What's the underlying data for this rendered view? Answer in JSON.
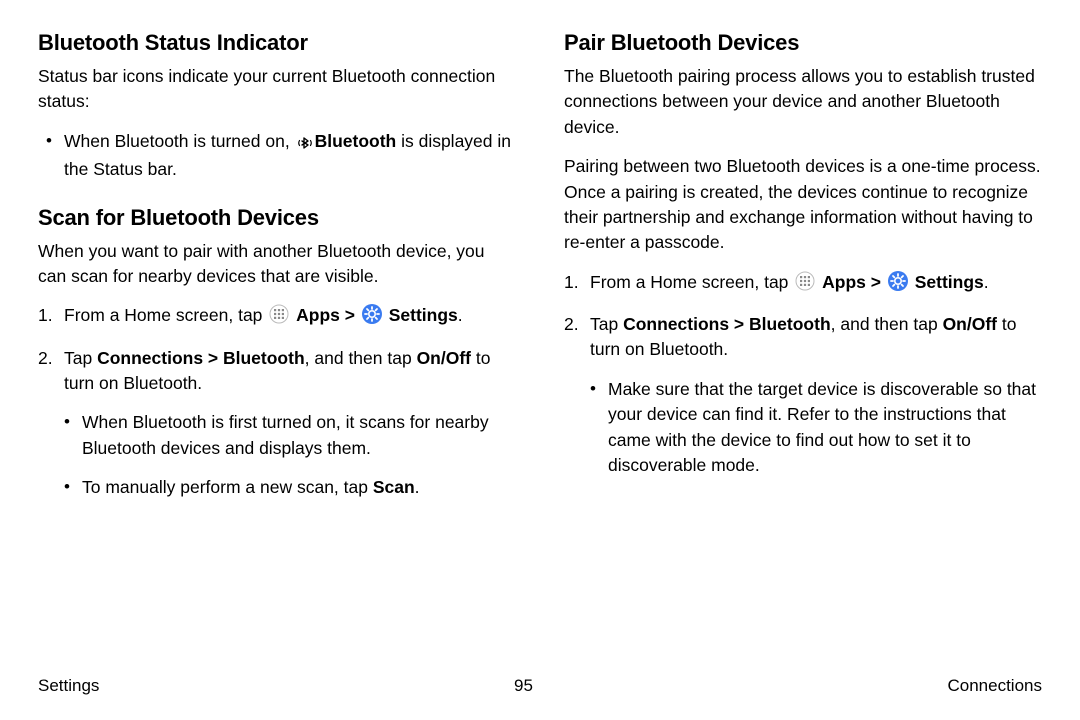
{
  "left": {
    "section1": {
      "heading": "Bluetooth Status Indicator",
      "intro": "Status bar icons indicate your current Bluetooth connection status:",
      "bullet_pre": "When Bluetooth is turned on, ",
      "bullet_bold": "Bluetooth",
      "bullet_post": " is displayed in the Status bar."
    },
    "section2": {
      "heading": "Scan for Bluetooth Devices",
      "intro": "When you want to pair with another Bluetooth device, you can scan for nearby devices that are visible.",
      "step1_pre": "From a Home screen, tap ",
      "apps": "Apps",
      "sep": " > ",
      "settings": "Settings",
      "step1_post": ".",
      "step2_pre": "Tap ",
      "step2_b1": "Connections > Bluetooth",
      "step2_mid": ", and then tap ",
      "step2_b2": "On/Off",
      "step2_post": " to turn on Bluetooth.",
      "sub1": "When Bluetooth is first turned on, it scans for nearby Bluetooth devices and displays them.",
      "sub2_pre": "To manually perform a new scan, tap ",
      "sub2_b": "Scan",
      "sub2_post": "."
    }
  },
  "right": {
    "section3": {
      "heading": "Pair Bluetooth Devices",
      "p1": "The Bluetooth pairing process allows you to establish trusted connections between your device and another Bluetooth device.",
      "p2": "Pairing between two Bluetooth devices is a one-time process. Once a pairing is created, the devices continue to recognize their partnership and exchange information without having to re-enter a passcode.",
      "step1_pre": "From a Home screen, tap ",
      "apps": "Apps",
      "sep": " > ",
      "settings": "Settings",
      "step1_post": ".",
      "step2_pre": "Tap ",
      "step2_b1": "Connections > Bluetooth",
      "step2_mid": ", and then tap ",
      "step2_b2": "On/Off",
      "step2_post": " to turn on Bluetooth.",
      "sub1": "Make sure that the target device is discoverable so that your device can find it. Refer to the instructions that came with the device to find out how to set it to discoverable mode."
    }
  },
  "footer": {
    "left": "Settings",
    "center": "95",
    "right": "Connections"
  }
}
